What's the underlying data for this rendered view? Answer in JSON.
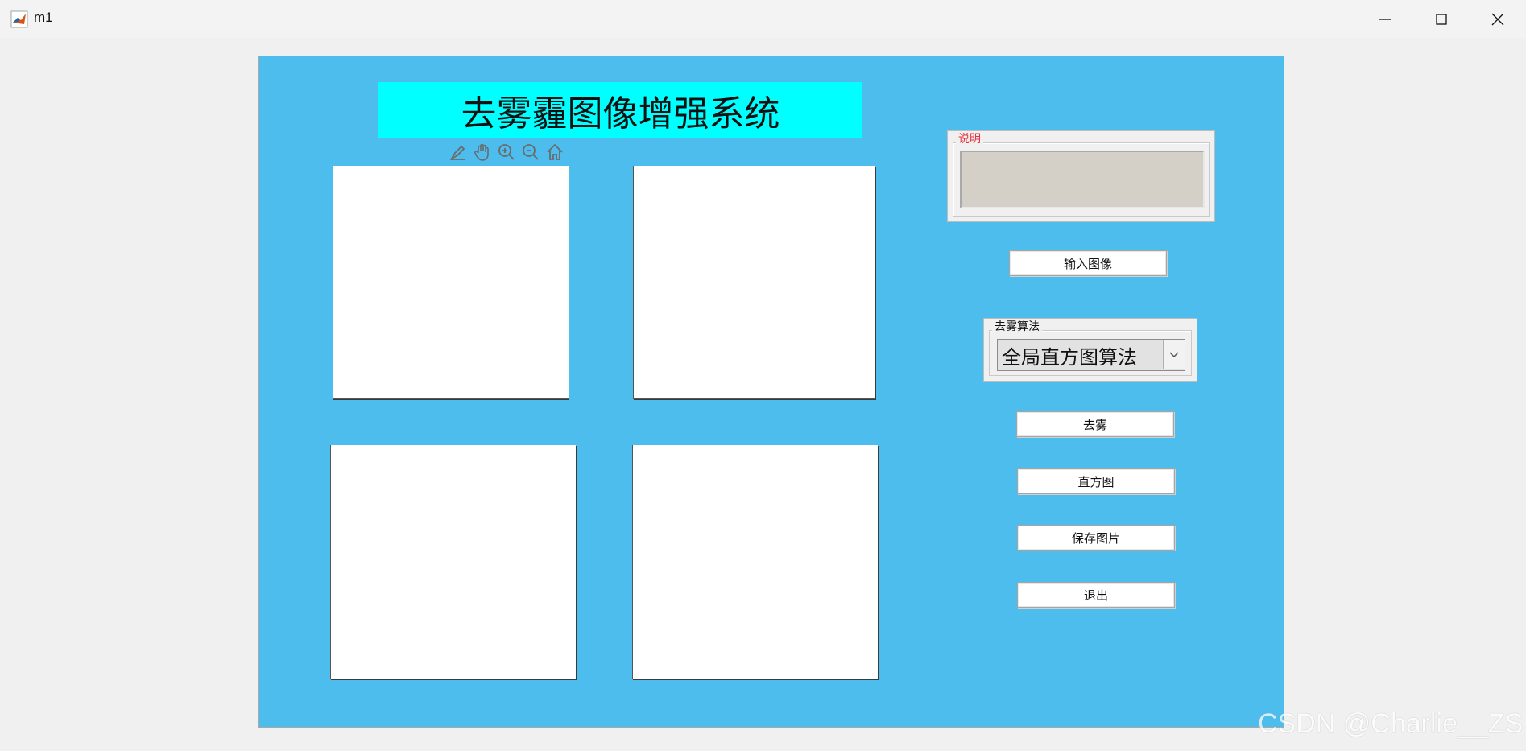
{
  "window": {
    "title": "m1",
    "icons": {
      "app": "matlab-logo-icon",
      "minimize": "minimize-icon",
      "maximize": "maximize-icon",
      "close": "close-icon"
    }
  },
  "figure": {
    "background_color": "#4dbded",
    "title": "去雾霾图像增强系统",
    "title_background": "#00ffff",
    "axes_toolbar": [
      "brush-icon",
      "pan-hand-icon",
      "zoom-in-icon",
      "zoom-out-icon",
      "home-icon"
    ]
  },
  "description_panel": {
    "legend": "说明",
    "legend_color": "#e8323c",
    "text": ""
  },
  "buttons": {
    "input_image": "输入图像",
    "dehaze": "去雾",
    "histogram": "直方图",
    "save_image": "保存图片",
    "exit": "退出"
  },
  "algorithm_panel": {
    "legend": "去雾算法",
    "selected": "全局直方图算法"
  },
  "watermark": "CSDN @Charlie__ZS"
}
